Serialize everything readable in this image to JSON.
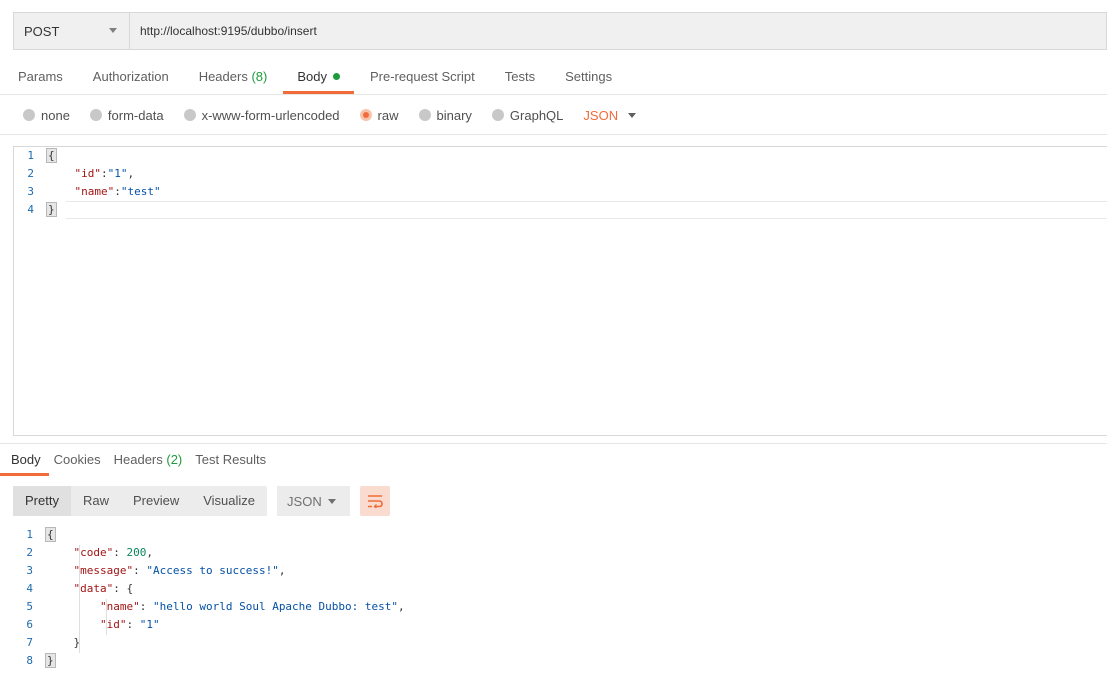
{
  "request": {
    "method": "POST",
    "url": "http://localhost:9195/dubbo/insert"
  },
  "req_tabs": [
    {
      "label": "Params"
    },
    {
      "label": "Authorization"
    },
    {
      "label": "Headers",
      "count": "(8)"
    },
    {
      "label": "Body"
    },
    {
      "label": "Pre-request Script"
    },
    {
      "label": "Tests"
    },
    {
      "label": "Settings"
    }
  ],
  "body_types": {
    "none": "none",
    "form_data": "form-data",
    "urlencoded": "x-www-form-urlencoded",
    "raw": "raw",
    "binary": "binary",
    "graphql": "GraphQL",
    "format": "JSON",
    "selected": "raw"
  },
  "request_body": {
    "line_numbers": [
      "1",
      "2",
      "3",
      "4"
    ],
    "open": "{",
    "id_key": "\"id\"",
    "id_val": "\"1\"",
    "name_key": "\"name\"",
    "name_val": "\"test\"",
    "close": "}"
  },
  "resp_tabs": [
    {
      "label": "Body"
    },
    {
      "label": "Cookies"
    },
    {
      "label": "Headers",
      "count": "(2)"
    },
    {
      "label": "Test Results"
    }
  ],
  "view_modes": {
    "pretty": "Pretty",
    "raw": "Raw",
    "preview": "Preview",
    "visualize": "Visualize",
    "lang": "JSON"
  },
  "response_body": {
    "line_numbers": [
      "1",
      "2",
      "3",
      "4",
      "5",
      "6",
      "7",
      "8"
    ],
    "open": "{",
    "code_key": "\"code\"",
    "code_val": "200",
    "message_key": "\"message\"",
    "message_val": "\"Access to success!\"",
    "data_key": "\"data\"",
    "name_key": "\"name\"",
    "name_val": "\"hello world Soul Apache Dubbo: test\"",
    "id_key": "\"id\"",
    "id_val": "\"1\"",
    "inner_close": "}",
    "close": "}"
  },
  "colors": {
    "accent": "#f26b3a",
    "success": "#1e9b3d",
    "json_key": "#a31515",
    "json_string": "#0451a5",
    "json_number": "#098658"
  }
}
